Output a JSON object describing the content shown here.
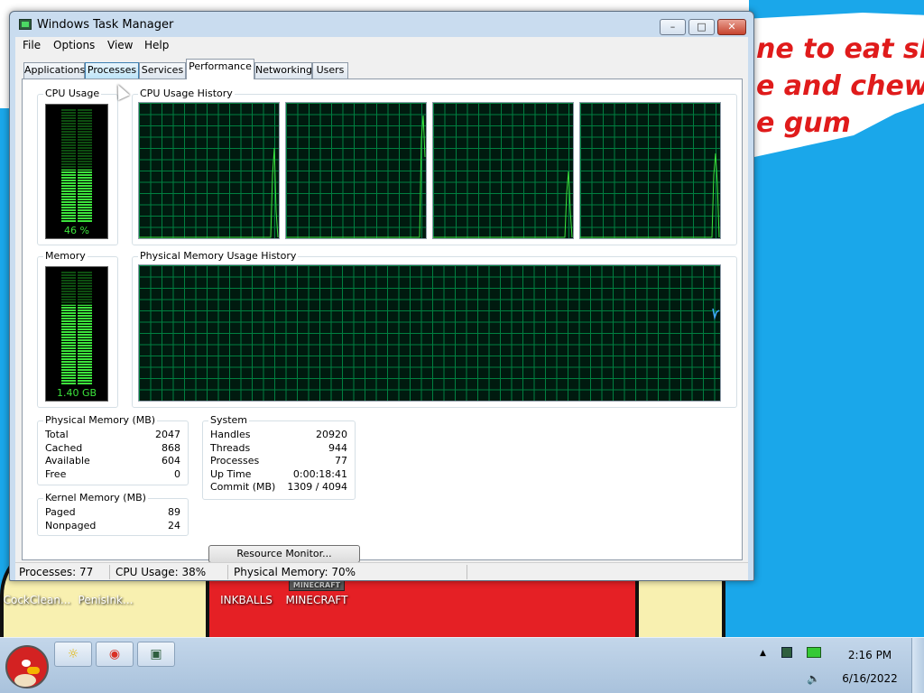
{
  "desktop": {
    "meme_text": "ne to eat shit\ne and chew\ne gum",
    "icons": [
      {
        "label": "CockClean..."
      },
      {
        "label": "PenisInk..."
      },
      {
        "label": "INKBALLS"
      },
      {
        "label": "MINECRAFT",
        "logo": "MINECRAFT"
      }
    ]
  },
  "window": {
    "title": "Windows Task Manager",
    "controls": {
      "minimize": "–",
      "maximize": "□",
      "close": "✕"
    },
    "menu": [
      "File",
      "Options",
      "View",
      "Help"
    ],
    "tabs": [
      "Applications",
      "Processes",
      "Services",
      "Performance",
      "Networking",
      "Users"
    ],
    "active_tab": "Performance",
    "hover_tab": "Processes"
  },
  "performance": {
    "cpu_usage": {
      "title": "CPU Usage",
      "label": "46 %",
      "percent": 46
    },
    "cpu_history": {
      "title": "CPU Usage History",
      "cores": 4
    },
    "memory": {
      "title": "Memory",
      "label": "1.40 GB",
      "percent": 70
    },
    "memory_history": {
      "title": "Physical Memory Usage History"
    },
    "physical_memory": {
      "title": "Physical Memory (MB)",
      "rows": [
        {
          "label": "Total",
          "value": "2047"
        },
        {
          "label": "Cached",
          "value": "868"
        },
        {
          "label": "Available",
          "value": "604"
        },
        {
          "label": "Free",
          "value": "0"
        }
      ]
    },
    "kernel_memory": {
      "title": "Kernel Memory (MB)",
      "rows": [
        {
          "label": "Paged",
          "value": "89"
        },
        {
          "label": "Nonpaged",
          "value": "24"
        }
      ]
    },
    "system": {
      "title": "System",
      "rows": [
        {
          "label": "Handles",
          "value": "20920"
        },
        {
          "label": "Threads",
          "value": "944"
        },
        {
          "label": "Processes",
          "value": "77"
        },
        {
          "label": "Up Time",
          "value": "0:00:18:41"
        },
        {
          "label": "Commit (MB)",
          "value": "1309 / 4094"
        }
      ]
    },
    "resource_monitor_button": "Resource Monitor..."
  },
  "statusbar": {
    "processes": "Processes: 77",
    "cpu": "CPU Usage: 38%",
    "memory": "Physical Memory: 70%"
  },
  "taskbar": {
    "pinned": [
      {
        "name": "explorer-icon",
        "glyph": "☼"
      },
      {
        "name": "chrome-icon",
        "glyph": "◉"
      },
      {
        "name": "task-manager-icon",
        "glyph": "▣"
      }
    ],
    "tray": {
      "show_hidden": "▲",
      "time": "2:16 PM",
      "date": "6/16/2022"
    }
  }
}
